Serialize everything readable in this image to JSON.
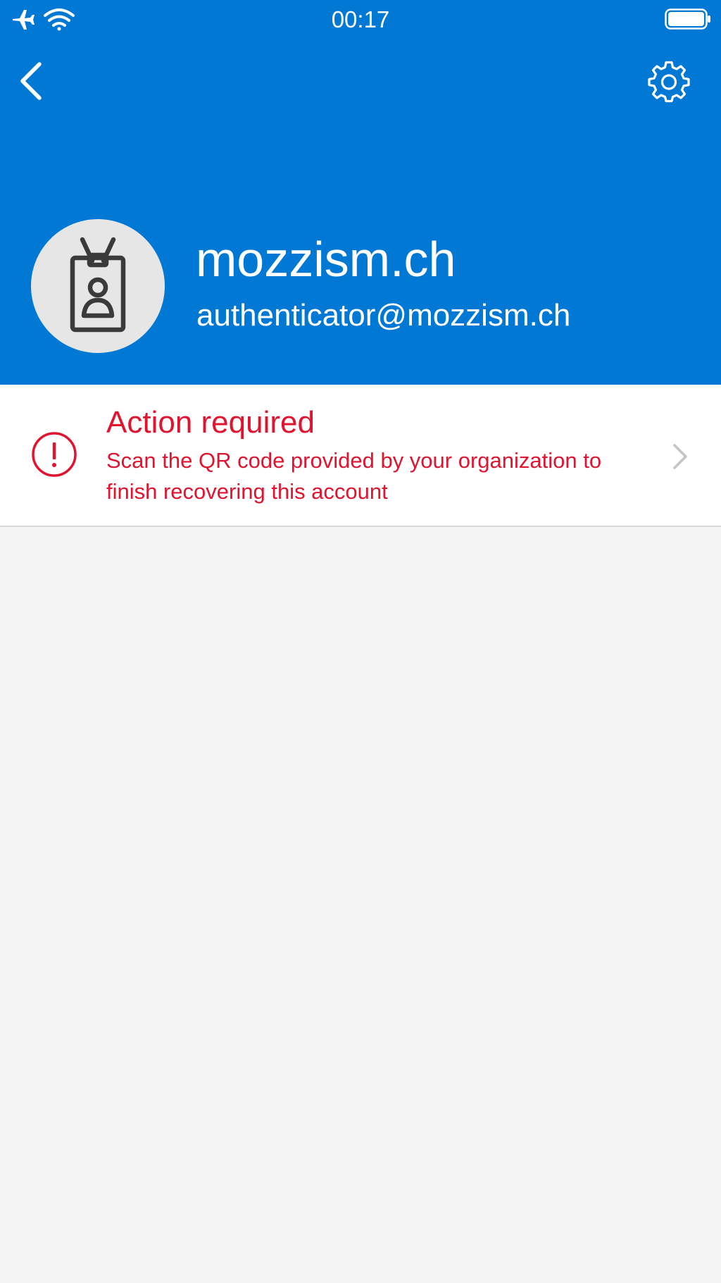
{
  "status_bar": {
    "time": "00:17",
    "icons": [
      "airplane-icon",
      "wifi-icon",
      "battery-icon"
    ]
  },
  "nav": {
    "back_icon": "chevron-left-icon",
    "settings_icon": "gear-icon"
  },
  "account": {
    "name": "mozzism.ch",
    "email": "authenticator@mozzism.ch",
    "avatar_icon": "id-badge-icon"
  },
  "action": {
    "title": "Action required",
    "description": "Scan the QR code provided by your organization to finish recovering this account",
    "icon": "alert-circle-icon",
    "chevron_icon": "chevron-right-icon"
  },
  "colors": {
    "header_bg": "#0078d4",
    "alert_red": "#e0142e",
    "page_bg": "#f4f4f4",
    "avatar_bg": "#e6e6e6"
  }
}
